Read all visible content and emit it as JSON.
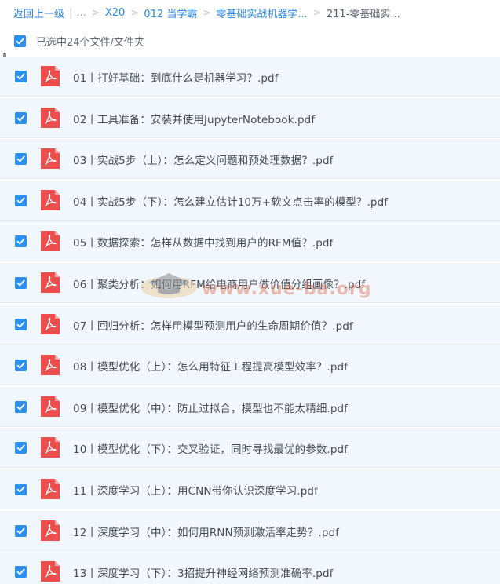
{
  "breadcrumb": {
    "back_label": "返回上一级",
    "ellipsis": "...",
    "items": [
      "X20",
      "012 当学霸",
      "零基础实战机器学...",
      "211-零基础实..."
    ]
  },
  "select_all": {
    "label": "已选中24个文件/文件夹",
    "checked": true
  },
  "accent_color": "#2b90f0",
  "pdf_icon_color": "#ee4d4d",
  "watermark": {
    "text": "www.xue-ba.org"
  },
  "files": [
    {
      "name": "01丨打好基础：到底什么是机器学习？.pdf",
      "checked": true,
      "icon": "pdf-icon"
    },
    {
      "name": "02丨工具准备：安装并使用JupyterNotebook.pdf",
      "checked": true,
      "icon": "pdf-icon"
    },
    {
      "name": "03丨实战5步（上）：怎么定义问题和预处理数据？.pdf",
      "checked": true,
      "icon": "pdf-icon"
    },
    {
      "name": "04丨实战5步（下）：怎么建立估计10万+软文点击率的模型？.pdf",
      "checked": true,
      "icon": "pdf-icon"
    },
    {
      "name": "05丨数据探索：怎样从数据中找到用户的RFM值？.pdf",
      "checked": true,
      "icon": "pdf-icon"
    },
    {
      "name": "06丨聚类分析：如何用RFM给电商用户做价值分组画像？.pdf",
      "checked": true,
      "icon": "pdf-icon"
    },
    {
      "name": "07丨回归分析：怎样用模型预测用户的生命周期价值？.pdf",
      "checked": true,
      "icon": "pdf-icon"
    },
    {
      "name": "08丨模型优化（上）：怎么用特征工程提高模型效率？.pdf",
      "checked": true,
      "icon": "pdf-icon"
    },
    {
      "name": "09丨模型优化（中）：防止过拟合，模型也不能太精细.pdf",
      "checked": true,
      "icon": "pdf-icon"
    },
    {
      "name": "10丨模型优化（下）：交叉验证，同时寻找最优的参数.pdf",
      "checked": true,
      "icon": "pdf-icon"
    },
    {
      "name": "11丨深度学习（上）：用CNN带你认识深度学习.pdf",
      "checked": true,
      "icon": "pdf-icon"
    },
    {
      "name": "12丨深度学习（中）：如何用RNN预测激活率走势？.pdf",
      "checked": true,
      "icon": "pdf-icon"
    },
    {
      "name": "13丨深度学习（下）：3招提升神经网络预测准确率.pdf",
      "checked": true,
      "icon": "pdf-icon"
    }
  ]
}
